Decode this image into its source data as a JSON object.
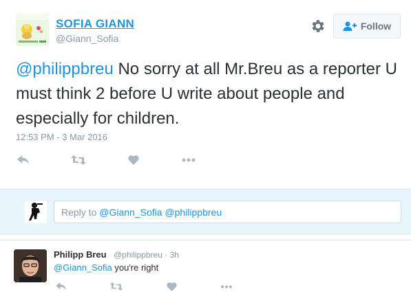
{
  "tweet": {
    "author_name": "SOFIA GIANN",
    "author_handle": "@Giann_Sofia",
    "follow_label": "Follow",
    "mention": "@philippbreu",
    "text": " No sorry at all Mr.Breu as a reporter U must think 2 before U write about people and especially for children.",
    "timestamp": "12:53 PM - 3 Mar 2016",
    "actions": [
      "reply-icon",
      "retweet-icon",
      "like-icon",
      "more-icon"
    ]
  },
  "reply_box": {
    "prefix": "Reply to ",
    "mentions": "@Giann_Sofia @philippbreu"
  },
  "reply_tweet": {
    "name": "Philipp Breu",
    "handle": "@philippbreu",
    "separator": " · ",
    "time": "3h",
    "mention": "@Giann_Sofia",
    "text": " you're right",
    "actions": [
      "reply-icon",
      "retweet-icon",
      "like-icon",
      "more-icon"
    ]
  },
  "colors": {
    "link": "#1b95e0",
    "muted": "#8899a6",
    "reply_bg": "#e8f5fd"
  }
}
